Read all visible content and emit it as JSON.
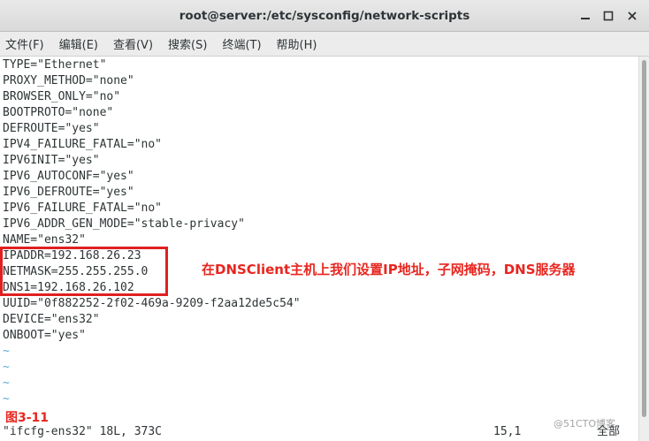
{
  "window": {
    "title": "root@server:/etc/sysconfig/network-scripts"
  },
  "menu": {
    "items": [
      "文件(F)",
      "编辑(E)",
      "查看(V)",
      "搜索(S)",
      "终端(T)",
      "帮助(H)"
    ]
  },
  "file_lines": [
    "TYPE=\"Ethernet\"",
    "PROXY_METHOD=\"none\"",
    "BROWSER_ONLY=\"no\"",
    "BOOTPROTO=\"none\"",
    "DEFROUTE=\"yes\"",
    "IPV4_FAILURE_FATAL=\"no\"",
    "IPV6INIT=\"yes\"",
    "IPV6_AUTOCONF=\"yes\"",
    "IPV6_DEFROUTE=\"yes\"",
    "IPV6_FAILURE_FATAL=\"no\"",
    "IPV6_ADDR_GEN_MODE=\"stable-privacy\"",
    "NAME=\"ens32\"",
    "IPADDR=192.168.26.23",
    "NETMASK=255.255.255.0",
    "DNS1=192.168.26.102",
    "UUID=\"0f882252-2f02-469a-9209-f2aa12de5c54\"",
    "DEVICE=\"ens32\"",
    "ONBOOT=\"yes\"",
    "~",
    "~",
    "~",
    "~"
  ],
  "annotation": {
    "text": "在DNSClient主机上我们设置IP地址，子网掩码，DNS服务器",
    "color": "#e8261f"
  },
  "figure_label": "图3-11",
  "status": {
    "file_info": "\"ifcfg-ens32\" 18L, 373C",
    "cursor": "15,1",
    "scope": "全部"
  },
  "watermark": "@51CTO博客"
}
